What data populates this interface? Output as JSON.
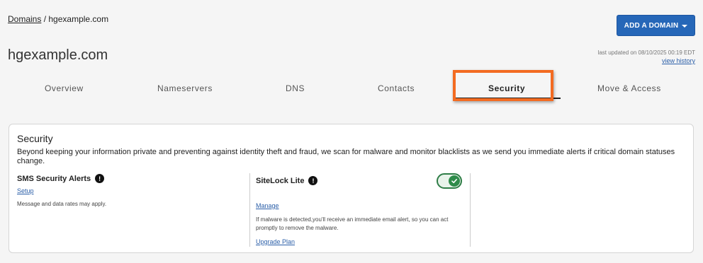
{
  "breadcrumb": {
    "parent": "Domains",
    "separator": " / ",
    "current": "hgexample.com"
  },
  "header": {
    "add_domain_label": "ADD A DOMAIN",
    "title": "hgexample.com",
    "last_updated": "last updated on 08/10/2025 00:19 EDT",
    "view_history": "view history"
  },
  "tabs": [
    {
      "label": "Overview"
    },
    {
      "label": "Nameservers"
    },
    {
      "label": "DNS"
    },
    {
      "label": "Contacts"
    },
    {
      "label": "Security",
      "active": true
    },
    {
      "label": "Move & Access"
    }
  ],
  "security": {
    "title": "Security",
    "description": "Beyond keeping your information private and preventing against identity theft and fraud, we scan for malware and monitor blacklists as we send you immediate alerts if critical domain statuses change.",
    "sms": {
      "title": "SMS Security Alerts",
      "info_glyph": "!",
      "setup_label": "Setup",
      "note": "Message and data rates may apply."
    },
    "sitelock": {
      "title": "SiteLock Lite",
      "info_glyph": "!",
      "enabled": true,
      "toggle_glyph": "✓",
      "manage_label": "Manage",
      "note": "If malware is detected,you'll receive an immediate email alert, so you can act promptly to remove the malware.",
      "upgrade_label": "Upgrade Plan"
    }
  },
  "colors": {
    "accent": "#2667b8",
    "highlight": "#f36b21",
    "toggle_on": "#2e8b4a",
    "link": "#2a5ea8"
  }
}
